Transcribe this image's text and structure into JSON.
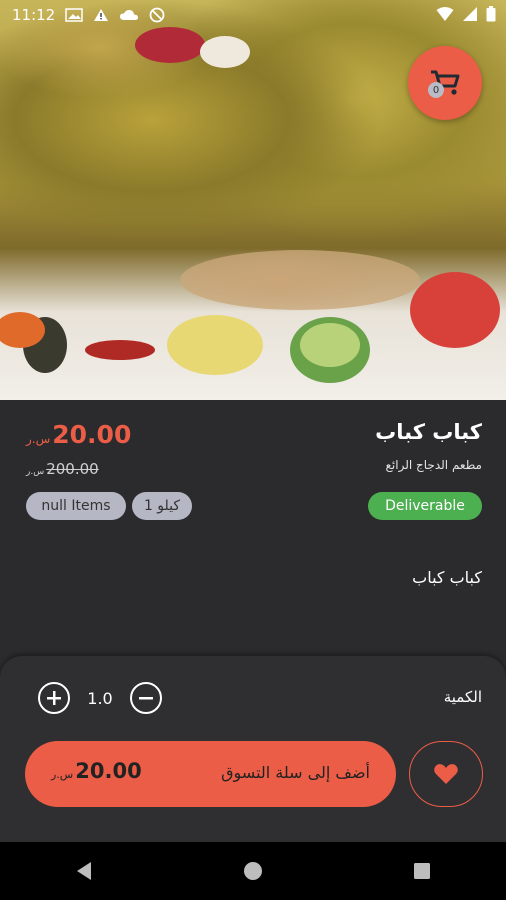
{
  "status_bar": {
    "time": "11:12"
  },
  "cart": {
    "count": "0"
  },
  "product": {
    "title": "كباب كباب",
    "restaurant": "مطعم الدجاج الرائع",
    "price": "20.00",
    "currency": "س.ر",
    "old_price": "200.00",
    "old_currency": "س.ر",
    "chips": {
      "items": "null Items",
      "unit": "1 كيلو",
      "delivery": "Deliverable"
    },
    "description": "كباب كباب"
  },
  "quantity": {
    "label": "الكمية",
    "value": "1.0"
  },
  "add_to_cart": {
    "label": "أضف إلى سلة التسوق",
    "price": "20.00",
    "currency": "س.ر"
  },
  "colors": {
    "accent": "#ec5d47",
    "deliverable": "#4caf50",
    "chip": "#b5b7c4",
    "background": "#2b2b2d"
  }
}
